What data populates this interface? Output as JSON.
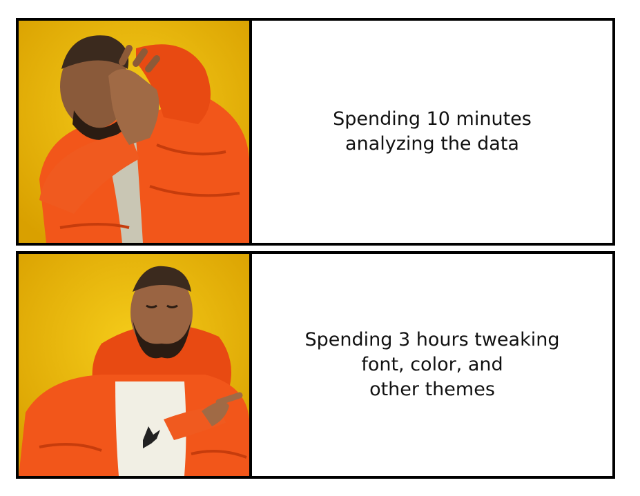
{
  "meme": {
    "panels": [
      {
        "id": "reject",
        "image_description_icon": "person-rejecting-icon",
        "caption": "Spending 10 minutes\n analyzing the data"
      },
      {
        "id": "approve",
        "image_description_icon": "person-approving-icon",
        "caption": "Spending 3 hours tweaking\nfont, color, and\n other themes"
      }
    ],
    "colors": {
      "background_yellow": "#e8b400",
      "jacket_orange": "#f2561a",
      "border": "#000000"
    }
  }
}
